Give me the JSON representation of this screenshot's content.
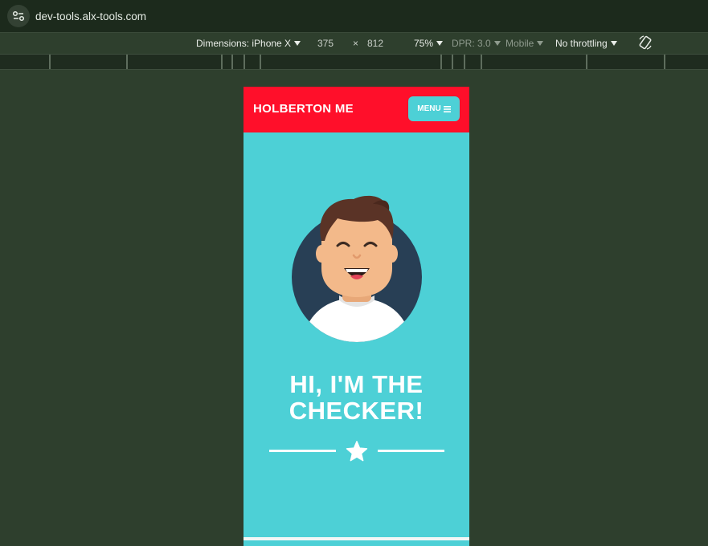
{
  "browser": {
    "url": "dev-tools.alx-tools.com"
  },
  "device_toolbar": {
    "dimensions_label": "Dimensions: iPhone X",
    "width": "375",
    "separator": "×",
    "height": "812",
    "zoom": "75%",
    "dpr": "DPR: 3.0",
    "mode": "Mobile",
    "throttling": "No throttling"
  },
  "page": {
    "brand": "HOLBERTON ME",
    "menu_label": "MENU",
    "headline_line1": "HI, I'M THE",
    "headline_line2": "CHECKER!"
  },
  "colors": {
    "nav_red": "#ff0f2a",
    "teal": "#4dd0d6",
    "avatar_circle": "#283f55",
    "skin": "#f3b98a",
    "hair": "#5a3326",
    "shirt": "#ffffff"
  }
}
